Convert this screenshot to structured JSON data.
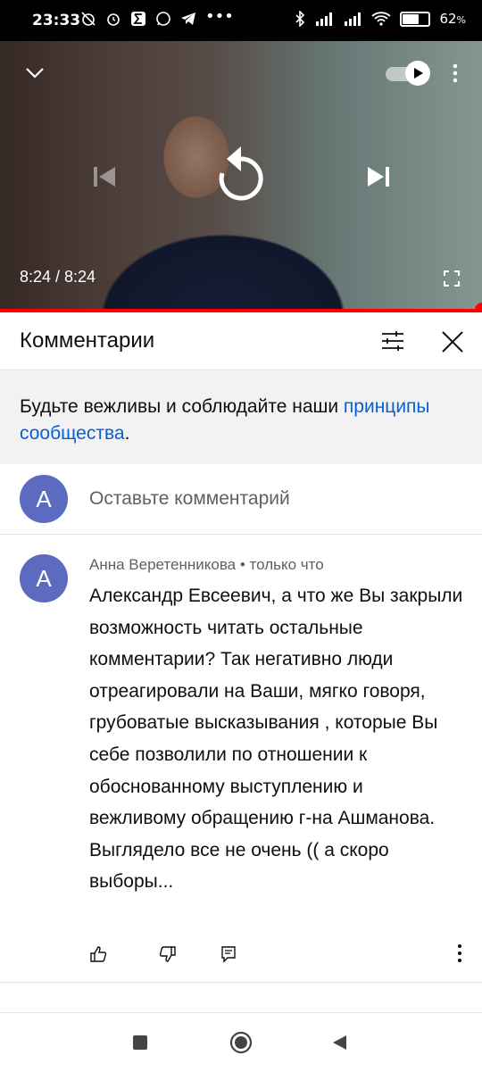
{
  "status_bar": {
    "time": "23:33",
    "battery": "62",
    "battery_unit": "%",
    "icons_left": [
      "alarm-off-icon",
      "alarm-icon",
      "sigma-app-icon",
      "whatsapp-icon",
      "telegram-icon",
      "more-dots-icon"
    ],
    "icons_right": [
      "bluetooth-icon",
      "signal-icon",
      "signal-icon",
      "wifi-icon",
      "battery-icon"
    ]
  },
  "player": {
    "time_display": "8:24 / 8:24",
    "progress": 1.0,
    "accent_color": "#ff0000"
  },
  "comments_panel": {
    "title": "Комментарии",
    "notice_text": "Будьте вежливы и соблюдайте наши ",
    "notice_link": "принципы сообщества",
    "notice_end": ".",
    "add_comment": {
      "avatar_letter": "A",
      "placeholder": "Оставьте комментарий"
    },
    "comments": [
      {
        "avatar_letter": "A",
        "author": "Анна Веретенникова",
        "separator": " • ",
        "time": "только что",
        "text": "Александр Евсеевич, а что же Вы закрыли возможность читать остальные комментарии? Так негативно люди отреагировали на Ваши, мягко говоря, грубоватые высказывания , которые Вы себе позволили по отношении к обоснованному выступлению и вежливому обращению г-на Ашманова. Выглядело все не очень (( а скоро выборы..."
      }
    ]
  },
  "colors": {
    "link": "#065fd4",
    "avatar": "#5c6bc0"
  }
}
